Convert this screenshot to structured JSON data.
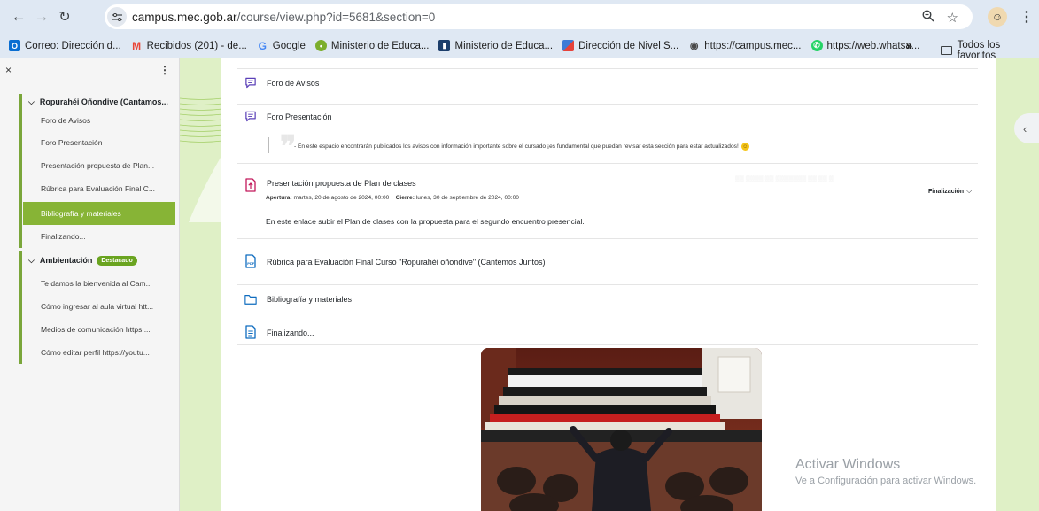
{
  "browser": {
    "url_host": "campus.mec.gob.ar",
    "url_path": "/course/view.php?id=5681&section=0",
    "bookmarks": [
      {
        "label": "Correo: Dirección d...",
        "icon": "outlook-icon",
        "color": "#0a6ed1"
      },
      {
        "label": "Recibidos (201) - de...",
        "icon": "gmail-icon",
        "color": "#ea4335"
      },
      {
        "label": "Google",
        "icon": "google-icon",
        "color": "#4285f4"
      },
      {
        "label": "Ministerio de Educa...",
        "icon": "ministerio-icon",
        "color": "#7cae2c"
      },
      {
        "label": "Ministerio de Educa...",
        "icon": "ministerio-dark-icon",
        "color": "#1c3e6b"
      },
      {
        "label": "Dirección de Nivel S...",
        "icon": "puzzle-icon",
        "color": "#3e7bd6"
      },
      {
        "label": "https://campus.mec...",
        "icon": "campus-icon",
        "color": "#4a4a4a"
      },
      {
        "label": "https://web.whatsa...",
        "icon": "whatsapp-icon",
        "color": "#25d366"
      }
    ],
    "more_bookmarks": "»",
    "all_bookmarks": "Todos los favoritos"
  },
  "drawer": {
    "close": "×",
    "menu": "⋮",
    "sections": [
      {
        "title": "Ropurahéi Oñondive (Cantamos...",
        "badge": "",
        "items": [
          {
            "label": "Foro de Avisos",
            "active": false
          },
          {
            "label": "Foro Presentación",
            "active": false
          },
          {
            "label": "Presentación propuesta de Plan...",
            "active": false
          },
          {
            "label": "Rúbrica para Evaluación Final C...",
            "active": false
          },
          {
            "label": "Bibliografía y materiales",
            "active": true
          },
          {
            "label": "Finalizando...",
            "active": false
          }
        ]
      },
      {
        "title": "Ambientación",
        "badge": "Destacado",
        "items": [
          {
            "label": "Te damos la bienvenida al Cam...",
            "active": false
          },
          {
            "label": "Cómo ingresar al aula virtual htt...",
            "active": false
          },
          {
            "label": "Medios de comunicación https:...",
            "active": false
          },
          {
            "label": "Cómo editar perfil https://youtu...",
            "active": false
          }
        ]
      }
    ]
  },
  "activities": {
    "foro_avisos": {
      "name": "Foro de Avisos",
      "icon": "forum-icon"
    },
    "foro_presentacion": {
      "name": "Foro Presentación",
      "icon": "forum-icon",
      "description": "- En este espacio encontrarán publicados los avisos con información importante sobre el cursado ¡es fundamental que puedan revisar esta sección para estar actualizados!"
    },
    "assignment": {
      "name": "Presentación propuesta de Plan de clases",
      "icon": "assignment-icon",
      "opening_label": "Apertura:",
      "opening_value": "martes, 20 de agosto de 2024, 00:00",
      "closing_label": "Cierre:",
      "closing_value": "lunes, 30 de septiembre de 2024, 00:00",
      "completion": "Finalización",
      "text": "En este enlace subir el Plan de clases con la propuesta para el segundo encuentro presencial."
    },
    "rubrica": {
      "name": "Rúbrica para Evaluación Final Curso \"Ropurahéi oñondive\" (Cantemos Juntos)",
      "icon": "pdf-icon"
    },
    "bibliografia": {
      "name": "Bibliografía y materiales",
      "icon": "folder-icon"
    },
    "finalizando": {
      "name": "Finalizando...",
      "icon": "page-icon"
    }
  },
  "windows_watermark": {
    "title": "Activar Windows",
    "subtitle": "Ve a Configuración para activar Windows."
  },
  "colors": {
    "accent_green": "#87b436",
    "background_green": "#dff0c6",
    "activity_purple": "#5b40b8",
    "assignment_pink": "#c2185b",
    "resource_blue": "#0f6cbf"
  }
}
